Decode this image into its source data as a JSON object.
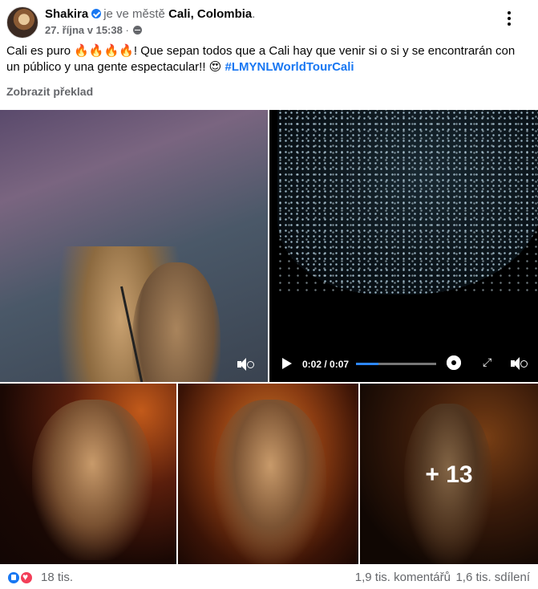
{
  "post": {
    "author": "Shakira",
    "location_prefix": "je ve městě",
    "location": "Cali, Colombia",
    "location_suffix": ".",
    "date": "27. října v 15:38",
    "date_sep": "·",
    "text_main": "Cali es puro 🔥🔥🔥🔥! Que sepan todos que a Cali hay que venir si o si y se encontrarán con un público y una gente espectacular!! 😍",
    "hashtag": "#LMYNLWorldTourCali",
    "translate_label": "Zobrazit překlad"
  },
  "video": {
    "time": "0:02 / 0:07",
    "progress": 0.28
  },
  "gallery": {
    "more_count": "+ 13"
  },
  "footer": {
    "reactions": "18 tis.",
    "comments": "1,9 tis. komentářů",
    "shares": "1,6 tis. sdílení"
  },
  "icons": [
    "verified-icon",
    "globe-icon",
    "more-options-icon",
    "play-icon",
    "settings-icon",
    "fullscreen-icon",
    "volume-muted-icon",
    "like-reaction-icon",
    "love-reaction-icon"
  ],
  "colors": {
    "accent": "#1877f2",
    "love": "#f33e58",
    "secondary_text": "#65676b"
  }
}
